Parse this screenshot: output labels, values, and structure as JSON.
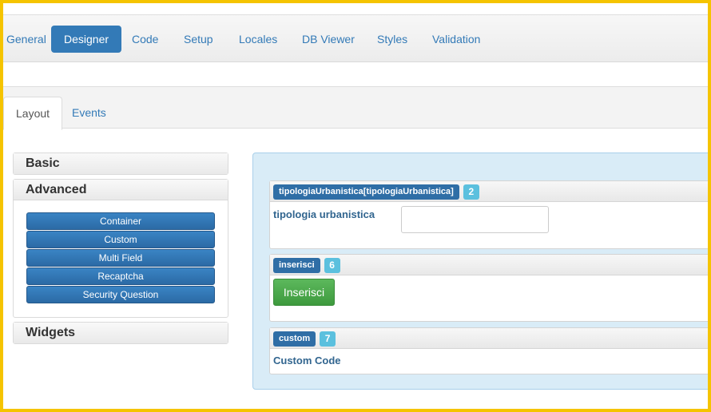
{
  "top_nav": {
    "items": [
      {
        "label": "General",
        "active": false
      },
      {
        "label": "Designer",
        "active": true
      },
      {
        "label": "Code",
        "active": false
      },
      {
        "label": "Setup",
        "active": false
      },
      {
        "label": "Locales",
        "active": false
      },
      {
        "label": "DB Viewer",
        "active": false
      },
      {
        "label": "Styles",
        "active": false
      },
      {
        "label": "Validation",
        "active": false
      }
    ]
  },
  "sub_tabs": {
    "items": [
      {
        "label": "Layout",
        "active": true
      },
      {
        "label": "Events",
        "active": false
      }
    ]
  },
  "palette": {
    "basic": {
      "title": "Basic"
    },
    "advanced": {
      "title": "Advanced",
      "buttons": [
        "Container",
        "Custom",
        "Multi Field",
        "Recaptcha",
        "Security Question"
      ]
    },
    "widgets": {
      "title": "Widgets"
    }
  },
  "form": {
    "fields": [
      {
        "name": "tipologiaUrbanistica[tipologiaUrbanistica]",
        "number": "2",
        "label": "tipologia urbanistica",
        "input_value": ""
      },
      {
        "name": "inserisci",
        "number": "6",
        "button_label": "Inserisci"
      },
      {
        "name": "custom",
        "number": "7",
        "label": "Custom Code"
      }
    ]
  },
  "colors": {
    "accent": "#337ab7",
    "badge_number": "#5bc0de",
    "button_green": "#5cb85c",
    "canvas_bg": "#d9ecf7",
    "frame": "#f5c400"
  }
}
